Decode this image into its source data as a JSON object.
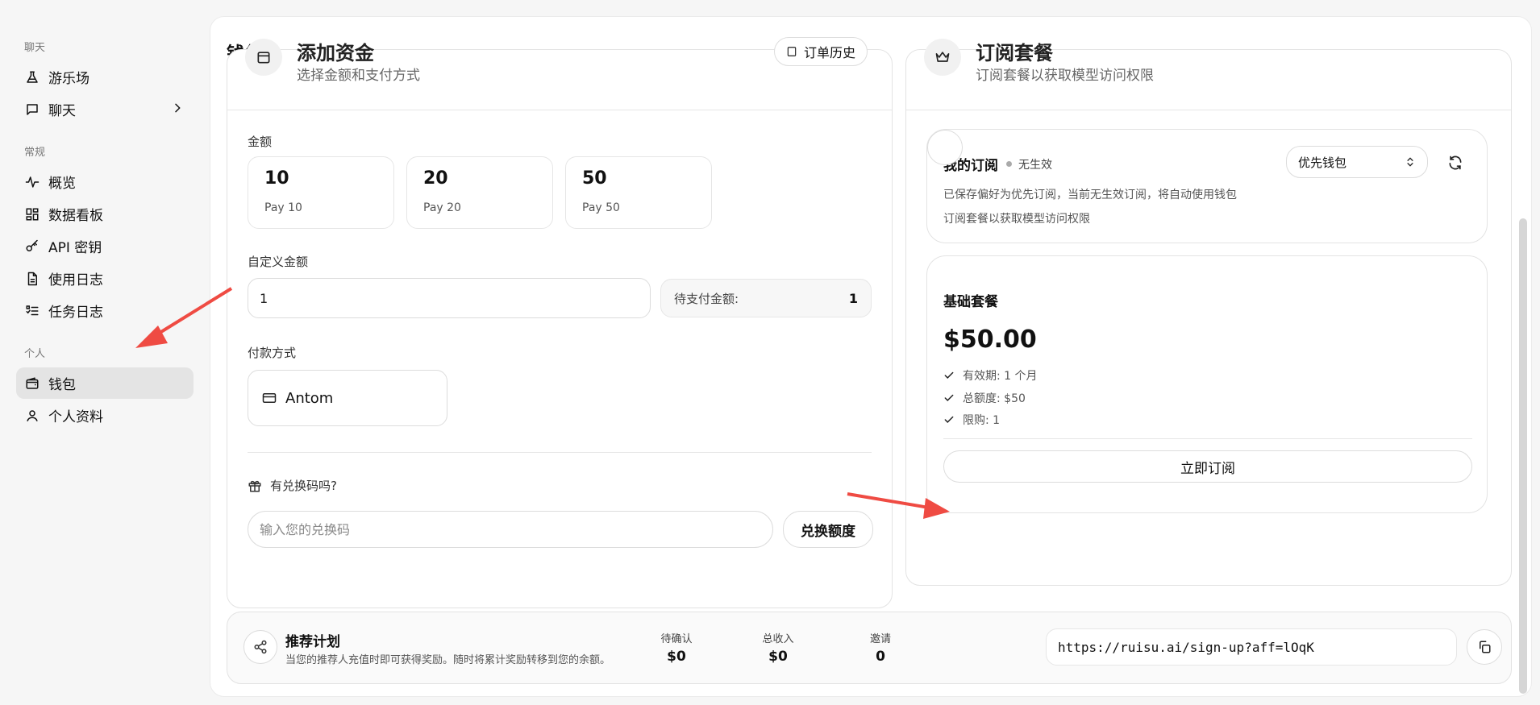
{
  "sidebar": {
    "sections": {
      "chat": "聊天",
      "general": "常规",
      "personal": "个人"
    },
    "items": [
      {
        "label": "游乐场",
        "icon": "flask-icon"
      },
      {
        "label": "聊天",
        "icon": "chat-bubble-icon"
      },
      {
        "label": "概览",
        "icon": "activity-icon"
      },
      {
        "label": "数据看板",
        "icon": "dashboard-grid-icon"
      },
      {
        "label": "API 密钥",
        "icon": "key-icon"
      },
      {
        "label": "使用日志",
        "icon": "document-icon"
      },
      {
        "label": "任务日志",
        "icon": "task-list-icon"
      },
      {
        "label": "钱包",
        "icon": "wallet-icon",
        "active": true
      },
      {
        "label": "个人资料",
        "icon": "user-icon"
      }
    ]
  },
  "page": {
    "title": "钱包"
  },
  "add_funds": {
    "title": "添加资金",
    "subtitle": "选择金额和支付方式",
    "order_history_label": "订单历史",
    "amount_label": "金额",
    "amounts": [
      {
        "value": "10",
        "caption": "Pay 10"
      },
      {
        "value": "20",
        "caption": "Pay 20"
      },
      {
        "value": "50",
        "caption": "Pay 50"
      }
    ],
    "custom_amount_label": "自定义金额",
    "custom_amount_value": "1",
    "pay_due_label": "待支付金额:",
    "pay_due_value": "1",
    "payment_method_label": "付款方式",
    "payment_method": "Antom",
    "redeem_question": "有兑换码吗?",
    "redeem_placeholder": "输入您的兑换码",
    "redeem_button": "兑换额度"
  },
  "subscription": {
    "title": "订阅套餐",
    "subtitle": "订阅套餐以获取模型访问权限",
    "my_sub": {
      "title": "我的订阅",
      "status": "无生效",
      "select_value": "优先钱包",
      "line1": "已保存偏好为优先订阅，当前无生效订阅，将自动使用钱包",
      "line2": "订阅套餐以获取模型访问权限"
    },
    "plan": {
      "name": "基础套餐",
      "price": "$50.00",
      "features": [
        "有效期: 1 个月",
        "总额度: $50",
        "限购: 1"
      ],
      "subscribe_button": "立即订阅"
    }
  },
  "referral": {
    "title": "推荐计划",
    "description": "当您的推荐人充值时即可获得奖励。随时将累计奖励转移到您的余额。",
    "stats": [
      {
        "label": "待确认",
        "value": "$0"
      },
      {
        "label": "总收入",
        "value": "$0"
      },
      {
        "label": "邀请",
        "value": "0"
      }
    ],
    "link": "https://ruisu.ai/sign-up?aff=lOqK"
  },
  "colors": {
    "annotation_arrow": "#ef4b43",
    "active_nav_bg": "#e4e4e4"
  }
}
